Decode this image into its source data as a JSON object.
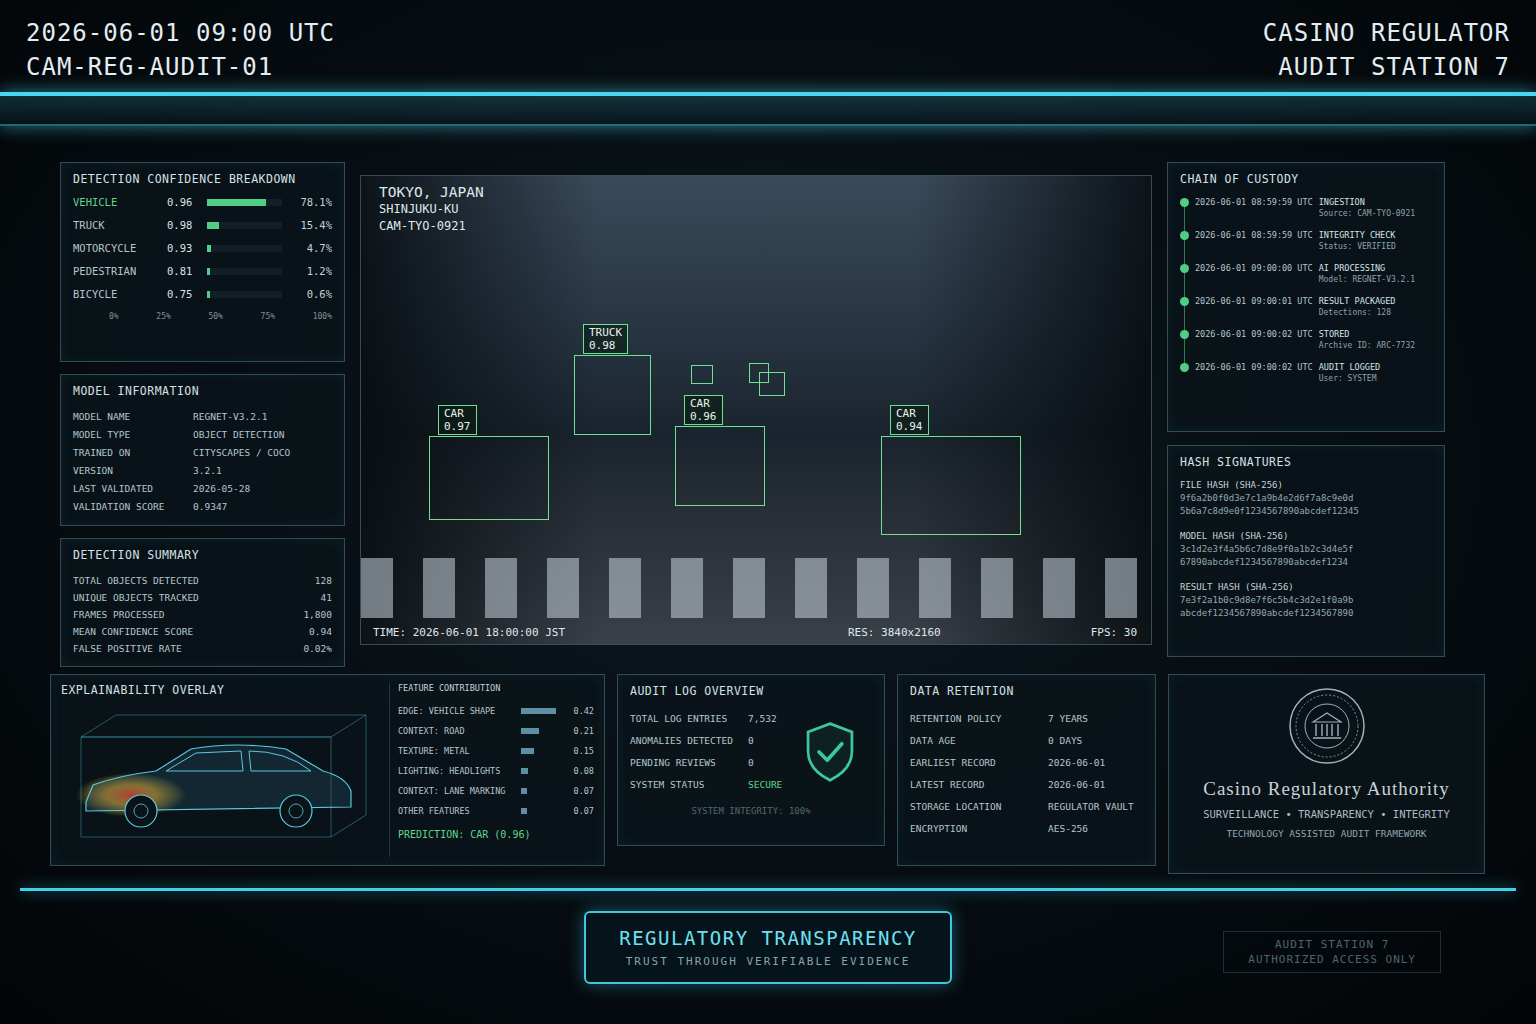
{
  "header": {
    "timestamp": "2026-06-01 09:00 UTC",
    "camera_id": "CAM-REG-AUDIT-01",
    "station_title": "CASINO REGULATOR",
    "station_name": "AUDIT STATION 7"
  },
  "confidence": {
    "title": "DETECTION CONFIDENCE BREAKDOWN",
    "rows": [
      {
        "label": "VEHICLE",
        "score": "0.96",
        "share": "78.1%",
        "level": 0.781,
        "highlight": true
      },
      {
        "label": "TRUCK",
        "score": "0.98",
        "share": "15.4%",
        "level": 0.154,
        "highlight": false
      },
      {
        "label": "MOTORCYCLE",
        "score": "0.93",
        "share": "4.7%",
        "level": 0.047,
        "highlight": false
      },
      {
        "label": "PEDESTRIAN",
        "score": "0.81",
        "share": "1.2%",
        "level": 0.012,
        "highlight": false
      },
      {
        "label": "BICYCLE",
        "score": "0.75",
        "share": "0.6%",
        "level": 0.006,
        "highlight": false
      }
    ],
    "ticks": [
      "0%",
      "25%",
      "50%",
      "75%",
      "100%"
    ]
  },
  "model_info": {
    "title": "MODEL INFORMATION",
    "rows": [
      {
        "key": "MODEL NAME",
        "value": "REGNET-V3.2.1"
      },
      {
        "key": "MODEL TYPE",
        "value": "OBJECT DETECTION"
      },
      {
        "key": "TRAINED ON",
        "value": "CITYSCAPES / COCO"
      },
      {
        "key": "VERSION",
        "value": "3.2.1"
      },
      {
        "key": "LAST VALIDATED",
        "value": "2026-05-28"
      },
      {
        "key": "VALIDATION SCORE",
        "value": "0.9347"
      }
    ]
  },
  "summary": {
    "title": "DETECTION SUMMARY",
    "rows": [
      {
        "key": "TOTAL OBJECTS DETECTED",
        "value": "128"
      },
      {
        "key": "UNIQUE OBJECTS TRACKED",
        "value": "41"
      },
      {
        "key": "FRAMES PROCESSED",
        "value": "1,800"
      },
      {
        "key": "MEAN CONFIDENCE SCORE",
        "value": "0.94"
      },
      {
        "key": "FALSE POSITIVE RATE",
        "value": "0.02%"
      }
    ]
  },
  "video": {
    "location": "TOKYO, JAPAN",
    "district": "SHINJUKU-KU",
    "camera": "CAM-TYO-0921",
    "time": "TIME: 2026-06-01 18:00:00 JST",
    "resolution": "RES: 3840x2160",
    "fps": "FPS: 30",
    "detections": [
      {
        "label": "CAR",
        "score": "0.97"
      },
      {
        "label": "TRUCK",
        "score": "0.98"
      },
      {
        "label": "CAR",
        "score": "0.96"
      },
      {
        "label": "CAR",
        "score": "0.94"
      }
    ]
  },
  "custody": {
    "title": "CHAIN OF CUSTODY",
    "events": [
      {
        "time": "2026-06-01 08:59:59 UTC",
        "event": "INGESTION",
        "detail": "Source: CAM-TYO-0921"
      },
      {
        "time": "2026-06-01 08:59:59 UTC",
        "event": "INTEGRITY CHECK",
        "detail": "Status: VERIFIED"
      },
      {
        "time": "2026-06-01 09:00:00 UTC",
        "event": "AI PROCESSING",
        "detail": "Model: REGNET-V3.2.1"
      },
      {
        "time": "2026-06-01 09:00:01 UTC",
        "event": "RESULT PACKAGED",
        "detail": "Detections: 128"
      },
      {
        "time": "2026-06-01 09:00:02 UTC",
        "event": "STORED",
        "detail": "Archive ID: ARC-7732"
      },
      {
        "time": "2026-06-01 09:00:02 UTC",
        "event": "AUDIT LOGGED",
        "detail": "User: SYSTEM"
      }
    ]
  },
  "hashes": {
    "title": "HASH SIGNATURES",
    "items": [
      {
        "label": "FILE HASH (SHA-256)",
        "lines": [
          "9f6a2b0f0d3e7c1a9b4e2d6f7a8c9e0d",
          "5b6a7c8d9e0f1234567890abcdef12345"
        ]
      },
      {
        "label": "MODEL HASH (SHA-256)",
        "lines": [
          "3c1d2e3f4a5b6c7d8e9f0a1b2c3d4e5f",
          "67890abcdef1234567890abcdef1234"
        ]
      },
      {
        "label": "RESULT HASH (SHA-256)",
        "lines": [
          "7e3f2a1b0c9d8e7f6c5b4c3d2e1f0a9b",
          "abcdef1234567890abcdef1234567890"
        ]
      }
    ]
  },
  "explain": {
    "title": "EXPLAINABILITY OVERLAY",
    "features_title": "FEATURE CONTRIBUTION",
    "features": [
      {
        "label": "EDGE: VEHICLE SHAPE",
        "value": "0.42",
        "level": 0.84
      },
      {
        "label": "CONTEXT: ROAD",
        "value": "0.21",
        "level": 0.42
      },
      {
        "label": "TEXTURE: METAL",
        "value": "0.15",
        "level": 0.3
      },
      {
        "label": "LIGHTING: HEADLIGHTS",
        "value": "0.08",
        "level": 0.16
      },
      {
        "label": "CONTEXT: LANE MARKING",
        "value": "0.07",
        "level": 0.14
      },
      {
        "label": "OTHER FEATURES",
        "value": "0.07",
        "level": 0.14
      }
    ],
    "prediction": "PREDICTION: CAR (0.96)"
  },
  "audit": {
    "title": "AUDIT LOG OVERVIEW",
    "rows": [
      {
        "key": "TOTAL LOG ENTRIES",
        "value": "7,532",
        "positive": false
      },
      {
        "key": "ANOMALIES DETECTED",
        "value": "0",
        "positive": false
      },
      {
        "key": "PENDING REVIEWS",
        "value": "0",
        "positive": false
      },
      {
        "key": "SYSTEM STATUS",
        "value": "SECURE",
        "positive": true
      }
    ],
    "integrity": "SYSTEM INTEGRITY: 100%"
  },
  "retention": {
    "title": "DATA RETENTION",
    "rows": [
      {
        "key": "RETENTION POLICY",
        "value": "7 YEARS"
      },
      {
        "key": "DATA AGE",
        "value": "0 DAYS"
      },
      {
        "key": "EARLIEST RECORD",
        "value": "2026-06-01"
      },
      {
        "key": "LATEST RECORD",
        "value": "2026-06-01"
      },
      {
        "key": "STORAGE LOCATION",
        "value": "REGULATOR VAULT"
      },
      {
        "key": "ENCRYPTION",
        "value": "AES-256"
      }
    ]
  },
  "authority": {
    "name": "Casino Regulatory Authority",
    "motto": "SURVEILLANCE • TRANSPARENCY • INTEGRITY",
    "framework": "TECHNOLOGY ASSISTED AUDIT FRAMEWORK"
  },
  "banner": {
    "title": "REGULATORY TRANSPARENCY",
    "subtitle": "TRUST THROUGH VERIFIABLE EVIDENCE"
  },
  "access": {
    "station": "AUDIT STATION 7",
    "note": "AUTHORIZED ACCESS ONLY"
  }
}
